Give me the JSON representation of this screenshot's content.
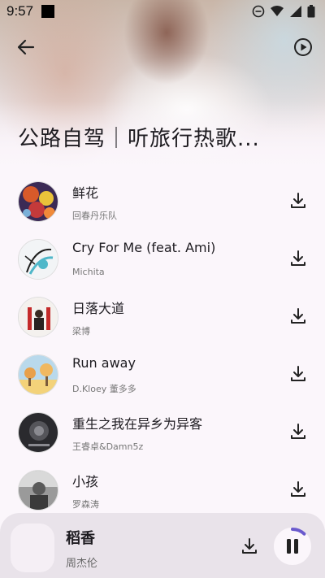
{
  "status_bar": {
    "time": "9:57",
    "icons": [
      "square-notification-icon",
      "do-not-disturb-icon",
      "wifi-icon",
      "signal-icon",
      "battery-icon"
    ]
  },
  "header": {
    "back_icon": "arrow-left-icon",
    "play_icon": "play-circle-icon",
    "playlist_title": "公路自驾｜听旅行热歌..."
  },
  "songs": [
    {
      "title": "鲜花",
      "artist": "回春丹乐队",
      "cover_colors": [
        "#d85a2a",
        "#e9c33a",
        "#4a2a6a"
      ]
    },
    {
      "title": "Cry For Me (feat. Ami)",
      "artist": "Michita",
      "cover_colors": [
        "#f2f4f6",
        "#4fb7c9",
        "#1e1e1e"
      ]
    },
    {
      "title": "日落大道",
      "artist": "梁博",
      "cover_colors": [
        "#f4f1ee",
        "#c42a2a",
        "#2a2222"
      ]
    },
    {
      "title": "Run away",
      "artist": "D.Kloey 董多多",
      "cover_colors": [
        "#b9d9ec",
        "#e8a04a",
        "#f3d27a"
      ]
    },
    {
      "title": "重生之我在异乡为异客",
      "artist": "王睿卓&Damn5z",
      "cover_colors": [
        "#2a2a2e",
        "#55555a",
        "#8a8a90"
      ]
    },
    {
      "title": "小孩",
      "artist": "罗森涛",
      "cover_colors": [
        "#5a5a5a",
        "#9a9a9a",
        "#d9d9d9"
      ]
    }
  ],
  "mini_player": {
    "title": "稻香",
    "artist": "周杰伦",
    "progress": 0.12,
    "accent_color": "#6a5acd",
    "pause_icon": "pause-icon",
    "download_icon": "download-icon"
  }
}
